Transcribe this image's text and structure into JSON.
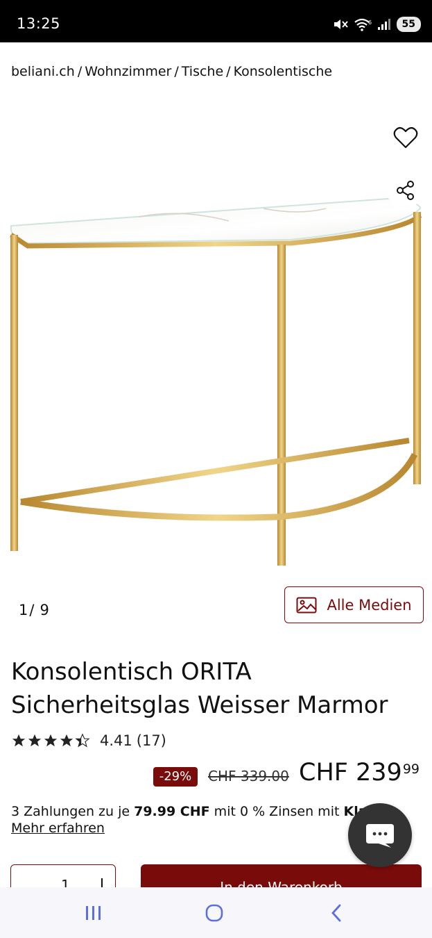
{
  "status_bar": {
    "time": "13:25",
    "battery": "55",
    "icons": [
      "mute-icon",
      "wifi-icon",
      "signal-icon",
      "battery-icon"
    ]
  },
  "breadcrumb": [
    {
      "label": "beliani.ch"
    },
    {
      "label": "Wohnzimmer"
    },
    {
      "label": "Tische"
    },
    {
      "label": "Konsolentische"
    }
  ],
  "breadcrumb_sep": "/",
  "gallery": {
    "current": "1",
    "slash": "/",
    "total": "9",
    "media_button_label": "Alle Medien"
  },
  "product": {
    "title_line1": "Konsolentisch ORITA",
    "title_line2": "Sicherheitsglas Weisser Marmor",
    "rating_value": "4.41",
    "rating_count": "(17)",
    "rating_stars": 4.41,
    "discount": "-29%",
    "old_price": "CHF 339.00",
    "new_price_main": "CHF 239",
    "new_price_cents": "99"
  },
  "installments": {
    "prefix": "3 Zahlungen zu je ",
    "amount": "79.99 CHF",
    "middle": " mit 0 % Zinsen mit ",
    "provider": "Klarna",
    "more_link": "Mehr erfahren"
  },
  "cart": {
    "quantity": "1",
    "add_button_label": "In den Warenkorb"
  },
  "colors": {
    "accent": "#7a0b0b",
    "gold": "#c9a24a",
    "nav_icon": "#5b6fe0"
  }
}
